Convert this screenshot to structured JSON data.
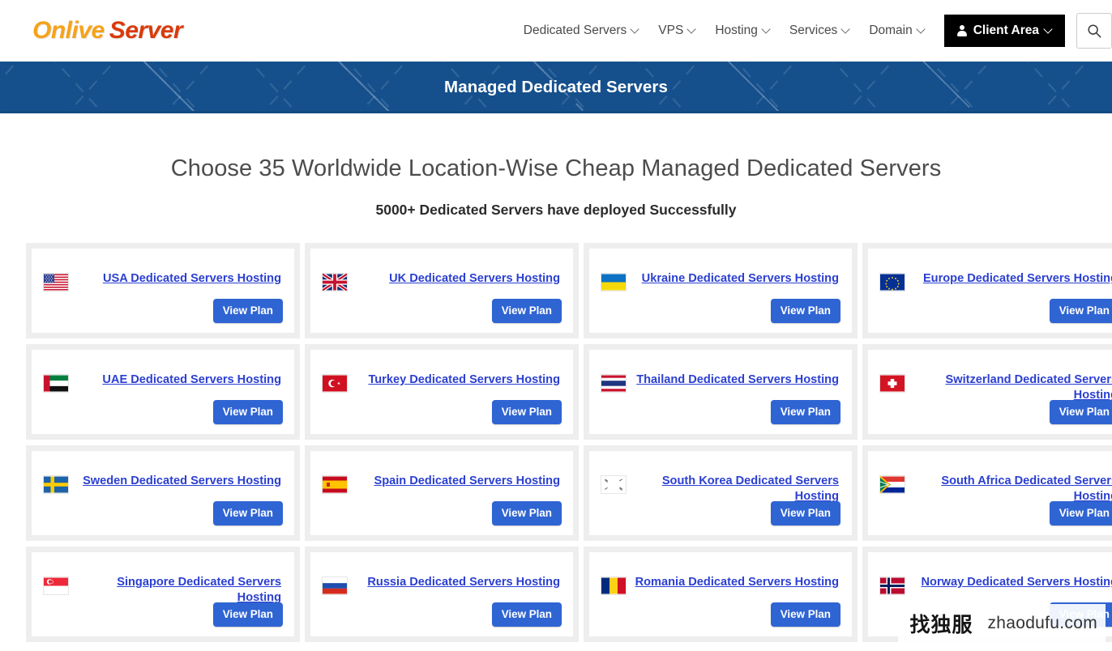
{
  "header": {
    "logo_part1": "Onlive",
    "logo_part2": "Server",
    "nav": [
      {
        "label": "Dedicated Servers",
        "has_dropdown": true
      },
      {
        "label": "VPS",
        "has_dropdown": true
      },
      {
        "label": "Hosting",
        "has_dropdown": true
      },
      {
        "label": "Services",
        "has_dropdown": true
      },
      {
        "label": "Domain",
        "has_dropdown": true
      }
    ],
    "client_area_label": "Client Area",
    "search_icon": "search-icon"
  },
  "banner": {
    "title": "Managed Dedicated Servers",
    "bg_color": "#15508c"
  },
  "headings": {
    "h1": "Choose 35 Worldwide Location-Wise Cheap Managed Dedicated Servers",
    "h2": "5000+ Dedicated Servers have deployed Successfully"
  },
  "cards": {
    "button_label": "View Plan",
    "link_color": "#2b3fd0",
    "button_color": "#2f64d3",
    "items": [
      {
        "title": "USA Dedicated Servers Hosting",
        "flag": "flag-usa",
        "button": "View Plan"
      },
      {
        "title": "UK Dedicated Servers Hosting",
        "flag": "flag-uk",
        "button": "View Plan"
      },
      {
        "title": "Ukraine Dedicated Servers Hosting",
        "flag": "flag-ukraine",
        "button": "View Plan"
      },
      {
        "title": "Europe Dedicated Servers Hosting",
        "flag": "flag-europe",
        "button": "View Plan"
      },
      {
        "title": "UAE Dedicated Servers Hosting",
        "flag": "flag-uae",
        "button": "View Plan"
      },
      {
        "title": "Turkey Dedicated Servers Hosting",
        "flag": "flag-turkey",
        "button": "View Plan"
      },
      {
        "title": "Thailand Dedicated Servers Hosting",
        "flag": "flag-thailand",
        "button": "View Plan"
      },
      {
        "title": "Switzerland Dedicated Servers Hosting",
        "flag": "flag-switzerland",
        "button": "View Plan"
      },
      {
        "title": "Sweden Dedicated Servers Hosting",
        "flag": "flag-sweden",
        "button": "View Plan"
      },
      {
        "title": "Spain Dedicated Servers Hosting",
        "flag": "flag-spain",
        "button": "View Plan"
      },
      {
        "title": "South Korea Dedicated Servers Hosting",
        "flag": "flag-south-korea",
        "button": "View Plan"
      },
      {
        "title": "South Africa Dedicated Servers Hosting",
        "flag": "flag-south-africa",
        "button": "View Plan"
      },
      {
        "title": "Singapore Dedicated Servers Hosting",
        "flag": "flag-singapore",
        "button": "View Plan"
      },
      {
        "title": "Russia Dedicated Servers Hosting",
        "flag": "flag-russia",
        "button": "View Plan"
      },
      {
        "title": "Romania Dedicated Servers Hosting",
        "flag": "flag-romania",
        "button": "View Plan"
      },
      {
        "title": "Norway Dedicated Servers Hosting",
        "flag": "flag-norway",
        "button": "View Plan"
      }
    ]
  },
  "watermarks": {
    "corner_cn": "找独服",
    "corner_en": "zhaodufu.com",
    "bg_cn": "找独服",
    "bg_en": "zhaodufu.com"
  }
}
